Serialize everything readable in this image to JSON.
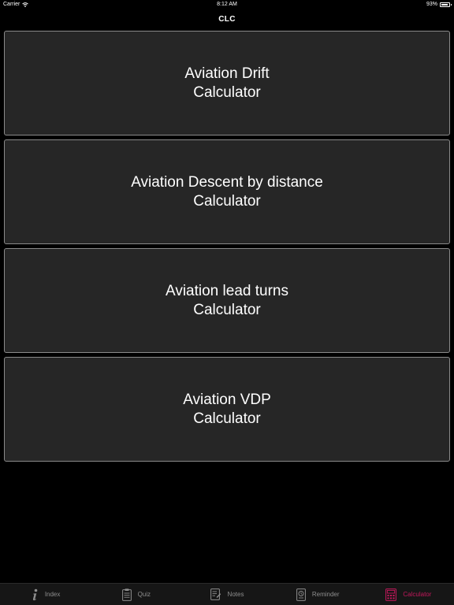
{
  "status_bar": {
    "carrier": "Carrier",
    "time": "8:12 AM",
    "battery": "93%",
    "battery_level": 0.93
  },
  "nav": {
    "title": "CLC"
  },
  "calculators": [
    {
      "line1": "Aviation Drift",
      "line2": "Calculator"
    },
    {
      "line1": "Aviation Descent by distance",
      "line2": "Calculator"
    },
    {
      "line1": "Aviation lead turns",
      "line2": "Calculator"
    },
    {
      "line1": "Aviation VDP",
      "line2": "Calculator"
    }
  ],
  "tabs": [
    {
      "label": "Index",
      "icon": "info-icon"
    },
    {
      "label": "Quiz",
      "icon": "clipboard-icon"
    },
    {
      "label": "Notes",
      "icon": "notes-icon"
    },
    {
      "label": "Reminder",
      "icon": "reminder-icon"
    },
    {
      "label": "Calculator",
      "icon": "calculator-icon",
      "active": true
    }
  ],
  "colors": {
    "background": "#000000",
    "card": "#262626",
    "card_border": "#8a8a8a",
    "tab_inactive": "#8e8e8e",
    "tab_active": "#c2185b"
  }
}
